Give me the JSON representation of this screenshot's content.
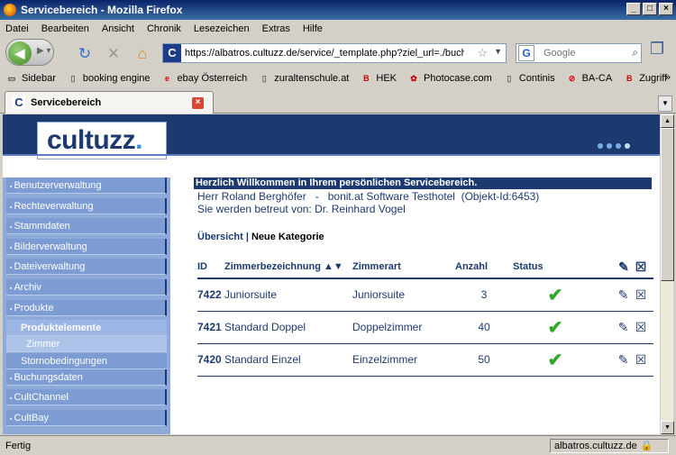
{
  "window": {
    "title": "Servicebereich - Mozilla Firefox"
  },
  "menu": [
    "Datei",
    "Bearbeiten",
    "Ansicht",
    "Chronik",
    "Lesezeichen",
    "Extras",
    "Hilfe"
  ],
  "nav": {
    "url": "https://albatros.cultuzz.de/service/_template.php?ziel_url=./buchungst",
    "search_placeholder": "Google"
  },
  "bookmarks": [
    {
      "label": "Sidebar",
      "icon": "monitor-icon"
    },
    {
      "label": "booking engine",
      "icon": "page-icon"
    },
    {
      "label": "ebay Österreich",
      "icon": "ebay-icon"
    },
    {
      "label": "zuraltenschule.at",
      "icon": "page-icon"
    },
    {
      "label": "HEK",
      "icon": "bonit-icon"
    },
    {
      "label": "Photocase.com",
      "icon": "photo-icon"
    },
    {
      "label": "Continis",
      "icon": "page-icon"
    },
    {
      "label": "BA-CA",
      "icon": "no-icon"
    },
    {
      "label": "Zugriff",
      "icon": "bonit-icon"
    }
  ],
  "tab": {
    "label": "Servicebereich"
  },
  "brand": {
    "logo": "cultuzz",
    "logo_dot": "."
  },
  "sidebar": [
    {
      "label": "Benutzerverwaltung",
      "type": "main"
    },
    {
      "label": "Rechteverwaltung",
      "type": "main"
    },
    {
      "label": "Stammdaten",
      "type": "main"
    },
    {
      "label": "Bilderverwaltung",
      "type": "main"
    },
    {
      "label": "Dateiverwaltung",
      "type": "main"
    },
    {
      "label": "Archiv",
      "type": "main"
    },
    {
      "label": "Produkte",
      "type": "main"
    },
    {
      "label": "Produktelemente",
      "type": "active"
    },
    {
      "label": "Zimmer",
      "type": "sel"
    },
    {
      "label": "Stornobedingungen",
      "type": "sub"
    },
    {
      "label": "Buchungsdaten",
      "type": "main"
    },
    {
      "label": "CultChannel",
      "type": "main"
    },
    {
      "label": "CultBay",
      "type": "main"
    }
  ],
  "main": {
    "welcome": "Herzlich Willkommen in Ihrem persönlichen Servicebereich.",
    "user_line": "Herr Roland Berghöfer   -   bonit.at Software Testhotel  (Objekt-Id:6453)",
    "support_line": "Sie werden betreut von: Dr. Reinhard Vogel",
    "link_overview": "Übersicht",
    "link_new": "Neue Kategorie",
    "link_sep": "|"
  },
  "table": {
    "headers": {
      "id": "ID",
      "name": "Zimmerbezeichnung ▲▼",
      "type": "Zimmerart",
      "count": "Anzahl",
      "status": "Status"
    },
    "rows": [
      {
        "id": "7422",
        "name": "Juniorsuite",
        "type": "Juniorsuite",
        "count": "3",
        "status": "active"
      },
      {
        "id": "7421",
        "name": "Standard Doppel",
        "type": "Doppelzimmer",
        "count": "40",
        "status": "active"
      },
      {
        "id": "7420",
        "name": "Standard Einzel",
        "type": "Einzelzimmer",
        "count": "50",
        "status": "active"
      }
    ]
  },
  "status": {
    "text": "Fertig",
    "domain": "albatros.cultuzz.de"
  }
}
